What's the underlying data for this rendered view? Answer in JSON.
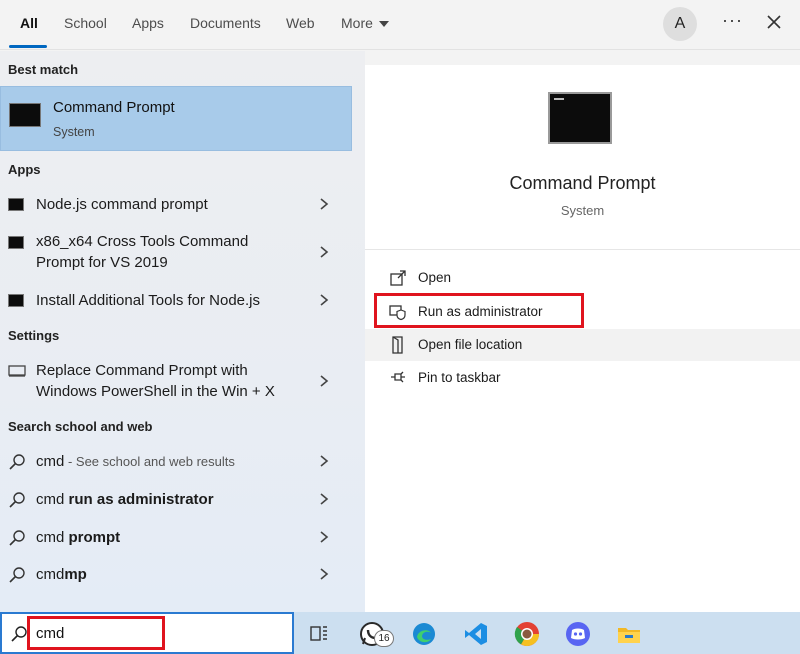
{
  "nav": {
    "tabs": [
      {
        "label": "All"
      },
      {
        "label": "School"
      },
      {
        "label": "Apps"
      },
      {
        "label": "Documents"
      },
      {
        "label": "Web"
      },
      {
        "label": "More"
      }
    ],
    "avatar_initial": "A",
    "dots": "···"
  },
  "left": {
    "best_match_heading": "Best match",
    "best_match": {
      "title": "Command Prompt",
      "subtitle": "System"
    },
    "apps_heading": "Apps",
    "apps": [
      {
        "lines": [
          "Node.js command prompt"
        ]
      },
      {
        "lines": [
          "x86_x64 Cross Tools Command",
          "Prompt for VS 2019"
        ]
      },
      {
        "lines": [
          "Install Additional Tools for Node.js"
        ]
      }
    ],
    "settings_heading": "Settings",
    "settings": [
      {
        "lines": [
          "Replace Command Prompt with",
          "Windows PowerShell in the Win + X"
        ]
      }
    ],
    "web_heading": "Search school and web",
    "web": [
      {
        "plain": "cmd",
        "bold": "",
        "hint": " - See school and web results"
      },
      {
        "plain": "cmd ",
        "bold": "run as administrator",
        "hint": ""
      },
      {
        "plain": "cmd ",
        "bold": "prompt",
        "hint": ""
      },
      {
        "plain": "cmd",
        "bold": "mp",
        "hint": ""
      }
    ]
  },
  "right": {
    "title": "Command Prompt",
    "subtitle": "System",
    "actions": [
      {
        "label": "Open",
        "icon": "open-icon"
      },
      {
        "label": "Run as administrator",
        "icon": "shield-icon"
      },
      {
        "label": "Open file location",
        "icon": "file-location-icon"
      },
      {
        "label": "Pin to taskbar",
        "icon": "pin-icon"
      }
    ]
  },
  "taskbar": {
    "search_value": "cmd",
    "whatsapp_badge": "16",
    "icons": [
      "task-view-icon",
      "whatsapp-icon",
      "edge-icon",
      "vscode-icon",
      "chrome-icon",
      "discord-icon",
      "file-explorer-icon"
    ]
  },
  "colors": {
    "selected_row": "#a8cbea",
    "accent": "#0067c0",
    "highlight": "#e0141e",
    "taskbar": "#ccdff0"
  }
}
